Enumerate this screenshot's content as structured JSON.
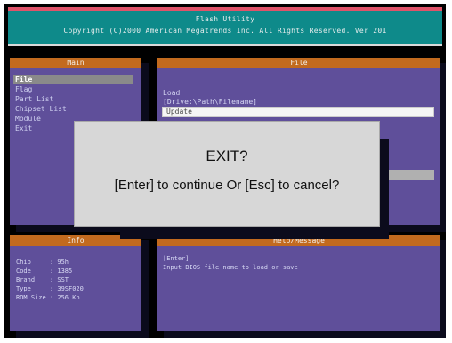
{
  "header": {
    "title": "Flash Utility",
    "copyright": "Copyright (C)2000 American Megatrends Inc. All Rights Reserved. Ver 201"
  },
  "main_panel": {
    "title": "Main",
    "items": [
      {
        "label": "File",
        "active": true
      },
      {
        "label": "Flag",
        "active": false
      },
      {
        "label": "Part List",
        "active": false
      },
      {
        "label": "Chipset List",
        "active": false
      },
      {
        "label": "Module",
        "active": false
      },
      {
        "label": "Exit",
        "active": false
      }
    ]
  },
  "file_panel": {
    "title": "File",
    "action": "Load",
    "path_hint": "[Drive:\\Path\\Filename]",
    "input_value": "Update"
  },
  "info_panel": {
    "title": "Info",
    "lines": [
      "Chip     : 95h",
      "Code     : 1385",
      "Brand    : SST",
      "Type     : 39SF020",
      "ROM Size : 256 Kb"
    ]
  },
  "help_panel": {
    "title": "Help/Message",
    "key": "[Enter]",
    "text": "Input BIOS file name to load or save"
  },
  "dialog": {
    "title": "EXIT?",
    "message": "[Enter] to continue Or [Esc] to cancel?"
  },
  "colors": {
    "panel": "#5f4f9a",
    "panel_header": "#c26a1e",
    "title_bar": "#0e8a8a",
    "dialog": "#d7d7d7"
  }
}
